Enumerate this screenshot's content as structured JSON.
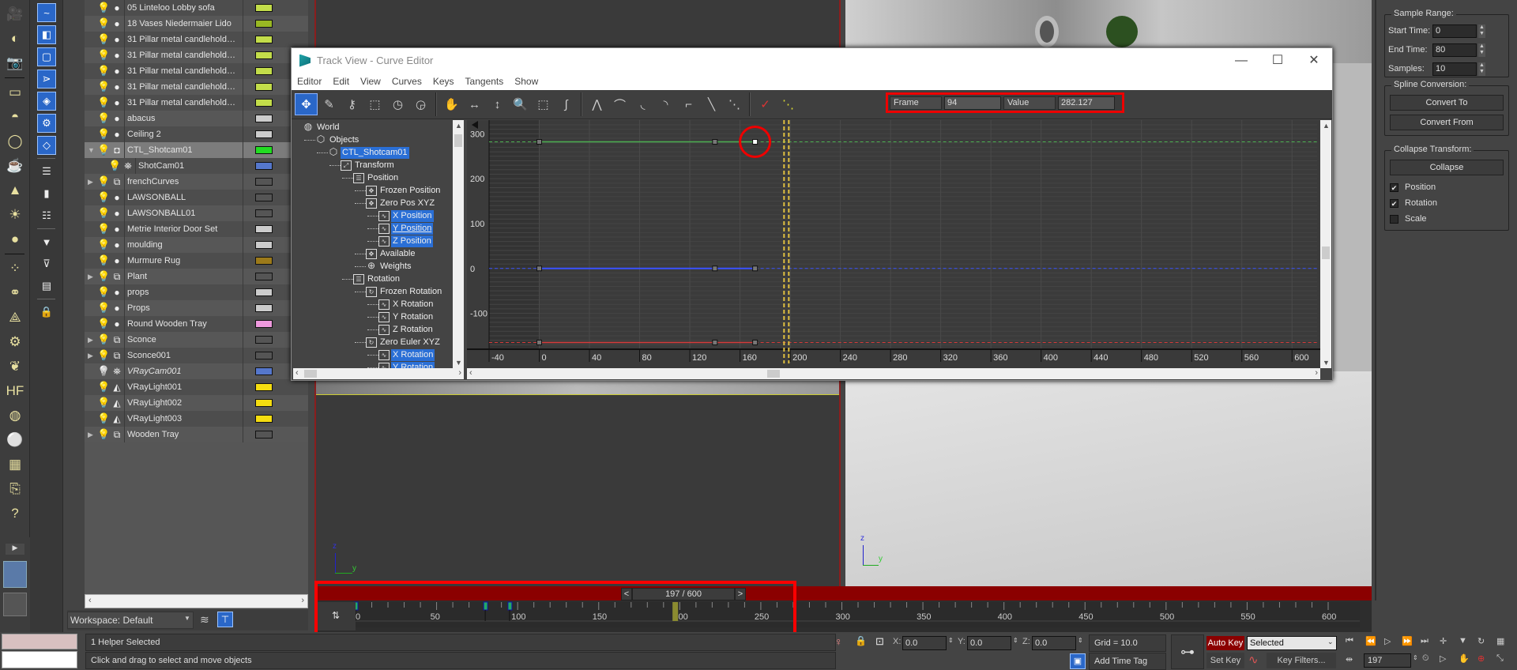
{
  "scene_explorer": {
    "items": [
      {
        "name": "05 Linteloo Lobby sofa",
        "color": "#c3dd4a",
        "type": "geo",
        "expand": false
      },
      {
        "name": "18 Vases Niedermaier Lido",
        "color": "#99b823",
        "type": "geo",
        "expand": false
      },
      {
        "name": "31 Pillar metal candlehold…",
        "color": "#c3dd4a",
        "type": "geo",
        "expand": false
      },
      {
        "name": "31 Pillar metal candlehold…",
        "color": "#c3dd4a",
        "type": "geo",
        "expand": false
      },
      {
        "name": "31 Pillar metal candlehold…",
        "color": "#c3dd4a",
        "type": "geo",
        "expand": false
      },
      {
        "name": "31 Pillar metal candlehold…",
        "color": "#c3dd4a",
        "type": "geo",
        "expand": false
      },
      {
        "name": "31 Pillar metal candlehold…",
        "color": "#c3dd4a",
        "type": "geo",
        "expand": false
      },
      {
        "name": "abacus",
        "color": "#cccccc",
        "type": "geo",
        "expand": false
      },
      {
        "name": "Ceiling 2",
        "color": "#cccccc",
        "type": "geo",
        "expand": false
      },
      {
        "name": "CTL_Shotcam01",
        "color": "#22dd22",
        "type": "helper",
        "expand": "open",
        "selected": true
      },
      {
        "name": "ShotCam01",
        "color": "#5577cc",
        "type": "camera",
        "expand": false,
        "child": true
      },
      {
        "name": "frenchCurves",
        "color": "#555555",
        "type": "group",
        "expand": true
      },
      {
        "name": "LAWSONBALL",
        "color": "#555555",
        "type": "geo",
        "expand": false
      },
      {
        "name": "LAWSONBALL01",
        "color": "#555555",
        "type": "geo",
        "expand": false
      },
      {
        "name": "Metrie Interior Door Set",
        "color": "#cccccc",
        "type": "geo",
        "expand": false
      },
      {
        "name": "moulding",
        "color": "#cccccc",
        "type": "geo",
        "expand": false
      },
      {
        "name": "Murmure Rug",
        "color": "#9c7a1a",
        "type": "geo",
        "expand": false
      },
      {
        "name": "Plant",
        "color": "#555555",
        "type": "group",
        "expand": true
      },
      {
        "name": "props",
        "color": "#cccccc",
        "type": "geo",
        "expand": false
      },
      {
        "name": "Props",
        "color": "#cccccc",
        "type": "geo",
        "expand": false
      },
      {
        "name": "Round Wooden Tray",
        "color": "#ee99dd",
        "type": "geo",
        "expand": false
      },
      {
        "name": "Sconce",
        "color": "#555555",
        "type": "group",
        "expand": true
      },
      {
        "name": "Sconce001",
        "color": "#555555",
        "type": "group",
        "expand": true
      },
      {
        "name": "VRayCam001",
        "color": "#5577cc",
        "type": "camera",
        "expand": false,
        "hidden": true
      },
      {
        "name": "VRayLight001",
        "color": "#f5dd10",
        "type": "light",
        "expand": false
      },
      {
        "name": "VRayLight002",
        "color": "#f5dd10",
        "type": "light",
        "expand": false
      },
      {
        "name": "VRayLight003",
        "color": "#f5dd10",
        "type": "light",
        "expand": false
      },
      {
        "name": "Wooden Tray",
        "color": "#555555",
        "type": "group",
        "expand": true
      }
    ],
    "workspace_label": "Workspace: Default"
  },
  "curve_editor": {
    "title": "Track View - Curve Editor",
    "menu": [
      "Editor",
      "Edit",
      "View",
      "Curves",
      "Keys",
      "Tangents",
      "Show"
    ],
    "frame_label": "Frame",
    "frame_value": "94",
    "value_label": "Value",
    "value_value": "282.127",
    "tree": [
      {
        "label": "World",
        "depth": 0,
        "icon": "globe"
      },
      {
        "label": "Objects",
        "depth": 1,
        "icon": "cube"
      },
      {
        "label": "CTL_Shotcam01",
        "depth": 2,
        "icon": "cube",
        "highlight": true
      },
      {
        "label": "Transform",
        "depth": 3,
        "icon": "transform"
      },
      {
        "label": "Position",
        "depth": 4,
        "icon": "list"
      },
      {
        "label": "Frozen Position",
        "depth": 5,
        "icon": "move"
      },
      {
        "label": "Zero Pos XYZ",
        "depth": 5,
        "icon": "move"
      },
      {
        "label": "X Position",
        "depth": 6,
        "icon": "curve",
        "highlight": true
      },
      {
        "label": "Y Position",
        "depth": 6,
        "icon": "curve",
        "highlight": true,
        "underline": true
      },
      {
        "label": "Z Position",
        "depth": 6,
        "icon": "curve",
        "highlight": true
      },
      {
        "label": "Available",
        "depth": 5,
        "icon": "move"
      },
      {
        "label": "Weights",
        "depth": 5,
        "icon": "plus"
      },
      {
        "label": "Rotation",
        "depth": 4,
        "icon": "list"
      },
      {
        "label": "Frozen Rotation",
        "depth": 5,
        "icon": "rotate"
      },
      {
        "label": "X Rotation",
        "depth": 6,
        "icon": "curve"
      },
      {
        "label": "Y Rotation",
        "depth": 6,
        "icon": "curve"
      },
      {
        "label": "Z Rotation",
        "depth": 6,
        "icon": "curve"
      },
      {
        "label": "Zero Euler XYZ",
        "depth": 5,
        "icon": "rotate"
      },
      {
        "label": "X Rotation",
        "depth": 6,
        "icon": "curve",
        "highlight": true
      },
      {
        "label": "Y Rotation",
        "depth": 6,
        "icon": "curve",
        "highlight": true
      }
    ]
  },
  "chart_data": {
    "type": "line",
    "title": "",
    "xlabel": "Frame",
    "ylabel": "Value",
    "xlim": [
      -40,
      620
    ],
    "ylim": [
      -180,
      320
    ],
    "x_ticks": [
      -40,
      0,
      40,
      80,
      120,
      160,
      200,
      240,
      280,
      320,
      360,
      400,
      440,
      480,
      520,
      560,
      600
    ],
    "y_ticks": [
      300,
      200,
      100,
      0,
      -100
    ],
    "current_frame": 197,
    "series": [
      {
        "name": "Y Position",
        "color": "#4caf50",
        "keys": [
          {
            "x": 0,
            "y": 282.127
          },
          {
            "x": 140,
            "y": 282.127
          },
          {
            "x": 172,
            "y": 282.127
          }
        ],
        "selected_key": 2
      },
      {
        "name": "Z Position",
        "color": "#3a52ff",
        "keys": [
          {
            "x": 0,
            "y": 0
          },
          {
            "x": 140,
            "y": 0
          },
          {
            "x": 172,
            "y": 0
          }
        ]
      },
      {
        "name": "X Position",
        "color": "#d43a3a",
        "keys": [
          {
            "x": 0,
            "y": -165
          },
          {
            "x": 140,
            "y": -165
          },
          {
            "x": 172,
            "y": -165
          }
        ]
      }
    ]
  },
  "command_panel": {
    "sample_range": "Sample Range:",
    "start_time_label": "Start Time:",
    "start_time": "0",
    "end_time_label": "End Time:",
    "end_time": "80",
    "samples_label": "Samples:",
    "samples": "10",
    "spline_conversion": "Spline Conversion:",
    "convert_to": "Convert To",
    "convert_from": "Convert From",
    "collapse_transform": "Collapse Transform:",
    "collapse": "Collapse",
    "position": "Position",
    "rotation": "Rotation",
    "scale": "Scale",
    "position_checked": true,
    "rotation_checked": true,
    "scale_checked": false
  },
  "timeline": {
    "slider_text": "197 / 600",
    "prev": "<",
    "next": ">",
    "ticks": [
      0,
      50,
      100,
      150,
      200,
      250,
      300,
      350,
      400,
      450,
      500,
      550,
      600
    ],
    "current_frame": 197,
    "keys": [
      0,
      80,
      95
    ]
  },
  "status": {
    "selection": "1 Helper Selected",
    "prompt": "Click and drag to select and move objects",
    "x_label": "X:",
    "x": "0.0",
    "y_label": "Y:",
    "y": "0.0",
    "z_label": "Z:",
    "z": "0.0",
    "grid": "Grid = 10.0",
    "add_time_tag": "Add Time Tag",
    "auto_key": "Auto Key",
    "set_key": "Set Key",
    "selected_dropdown": "Selected",
    "key_filters": "Key Filters...",
    "frame": "197"
  },
  "viewport_axes": {
    "z": "z",
    "y": "y"
  }
}
